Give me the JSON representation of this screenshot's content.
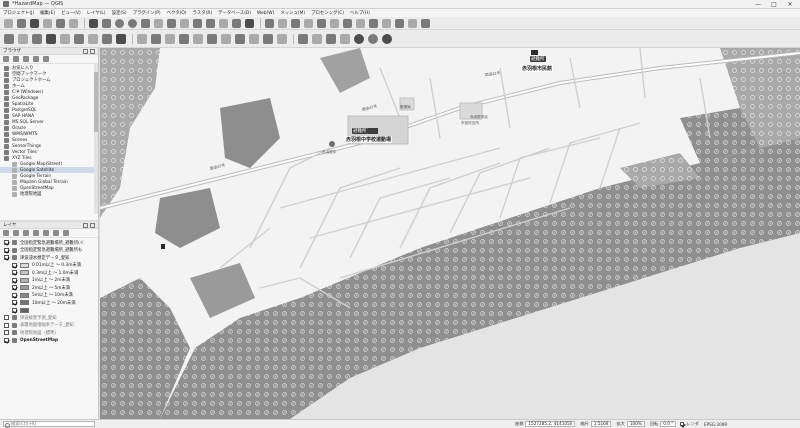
{
  "window": {
    "title": "*HazardMap — QGIS",
    "controls": [
      "—",
      "□",
      "✕"
    ]
  },
  "menubar": {
    "items": [
      "プロジェクト(J)",
      "編集(E)",
      "ビュー(V)",
      "レイヤ(L)",
      "設定(S)",
      "プラグイン(P)",
      "ベクタ(O)",
      "ラスタ(R)",
      "データベース(D)",
      "Web(W)",
      "メッシュ(M)",
      "プロセシング(C)",
      "ヘルプ(H)"
    ]
  },
  "browser_panel": {
    "title": "ブラウザ",
    "items": [
      {
        "label": "お気に入り",
        "icon": "star-icon",
        "indent": 1
      },
      {
        "label": "空間ブックマーク",
        "icon": "bookmark-icon",
        "indent": 1
      },
      {
        "label": "プロジェクトホーム",
        "icon": "folder-icon",
        "indent": 1
      },
      {
        "label": "ホーム",
        "icon": "folder-icon",
        "indent": 1
      },
      {
        "label": "C:¥ (Windows)",
        "icon": "drive-icon",
        "indent": 1
      },
      {
        "label": "GeoPackage",
        "icon": "database-icon",
        "indent": 1
      },
      {
        "label": "SpatiaLite",
        "icon": "database-icon",
        "indent": 1
      },
      {
        "label": "PostgreSQL",
        "icon": "elephant-icon",
        "indent": 1
      },
      {
        "label": "SAP HANA",
        "icon": "database-icon",
        "indent": 1
      },
      {
        "label": "MS SQL Server",
        "icon": "database-icon",
        "indent": 1
      },
      {
        "label": "Oracle",
        "icon": "database-icon",
        "indent": 1
      },
      {
        "label": "WMS/WMTS",
        "icon": "globe-icon",
        "indent": 1
      },
      {
        "label": "Scenes",
        "icon": "cube-icon",
        "indent": 1
      },
      {
        "label": "SensorThings",
        "icon": "sensor-icon",
        "indent": 1
      },
      {
        "label": "Vector Tiles",
        "icon": "grid-icon",
        "indent": 1
      },
      {
        "label": "XYZ Tiles",
        "icon": "grid-icon",
        "indent": 1
      },
      {
        "label": "Google Map(Street)",
        "icon": "tile-icon",
        "indent": 2
      },
      {
        "label": "Google Satellite",
        "icon": "tile-icon",
        "indent": 2,
        "selected": true
      },
      {
        "label": "Google Terrain",
        "icon": "tile-icon",
        "indent": 2
      },
      {
        "label": "Mapzen Global Terrain",
        "icon": "tile-icon",
        "indent": 2
      },
      {
        "label": "OpenStreetMap",
        "icon": "tile-icon",
        "indent": 2
      },
      {
        "label": "地理院地図",
        "icon": "tile-icon",
        "indent": 2
      }
    ]
  },
  "layers_panel": {
    "title": "レイヤ",
    "items": [
      {
        "label": "全国指定緊急避難場所_避難所(イ",
        "checked": true,
        "indent": 1,
        "kind": "point"
      },
      {
        "label": "全国指定緊急避難場所_避難所も",
        "checked": true,
        "indent": 1,
        "kind": "point"
      },
      {
        "label": "津波浸水想定データ_愛知",
        "checked": true,
        "indent": 1,
        "kind": "polygon"
      },
      {
        "label": "0.01m以上 ～ 0.3m未満",
        "checked": true,
        "indent": 2,
        "kind": "swatch",
        "shade": "#d8d8d8"
      },
      {
        "label": "0.3m以上 ～ 1.0m未満",
        "checked": true,
        "indent": 2,
        "kind": "swatch",
        "shade": "#c4c4c4"
      },
      {
        "label": "1m以上 ～ 2m未満",
        "checked": true,
        "indent": 2,
        "kind": "swatch",
        "shade": "#b0b0b0"
      },
      {
        "label": "2m以上 ～ 5m未満",
        "checked": true,
        "indent": 2,
        "kind": "swatch",
        "shade": "#9c9c9c"
      },
      {
        "label": "5m以上 ～ 10m未満",
        "checked": true,
        "indent": 2,
        "kind": "swatch",
        "shade": "#888888"
      },
      {
        "label": "10m以上 ～ 20m未満",
        "checked": true,
        "indent": 2,
        "kind": "swatch",
        "shade": "#747474"
      },
      {
        "label": "",
        "checked": true,
        "indent": 2,
        "kind": "swatch",
        "shade": "#606060"
      },
      {
        "label": "津波被害予測_愛知",
        "checked": false,
        "indent": 1,
        "kind": "polygon"
      },
      {
        "label": "表層地盤増幅率データ_愛知",
        "checked": false,
        "indent": 1,
        "kind": "polygon"
      },
      {
        "label": "地理院地図（標準）",
        "checked": false,
        "indent": 1,
        "kind": "raster"
      },
      {
        "label": "OpenStreetMap",
        "checked": true,
        "indent": 1,
        "kind": "raster"
      }
    ]
  },
  "map": {
    "labels": {
      "school": "赤羽根中学校運動場",
      "office": "赤羽根市民館",
      "school_badge": "避難所",
      "office_badge": "避難所",
      "road_1": "国道42号",
      "road_2": "国道42号",
      "road_3": "国道42号",
      "poi_1": "赤羽根中",
      "poi_2": "郵便局",
      "poi_3": "赤羽根市民",
      "poi_4": "市役所支所"
    }
  },
  "statusbar": {
    "search_placeholder": "検索(Ctrl+K)",
    "coordinate_label": "座標",
    "coordinate": "1527285.2, 4141050",
    "scale_label": "縮尺",
    "scale": "1:5168",
    "magnifier_label": "拡大",
    "magnifier": "100%",
    "rotation_label": "回転",
    "rotation": "0.0 °",
    "render_label": "レンダ",
    "crs": "EPSG:3099"
  },
  "colors": {
    "flood_fill": "#8f8f8f",
    "land": "#f3f3f3",
    "sea": "#e9e9e9",
    "road": "#b9b9b9"
  }
}
